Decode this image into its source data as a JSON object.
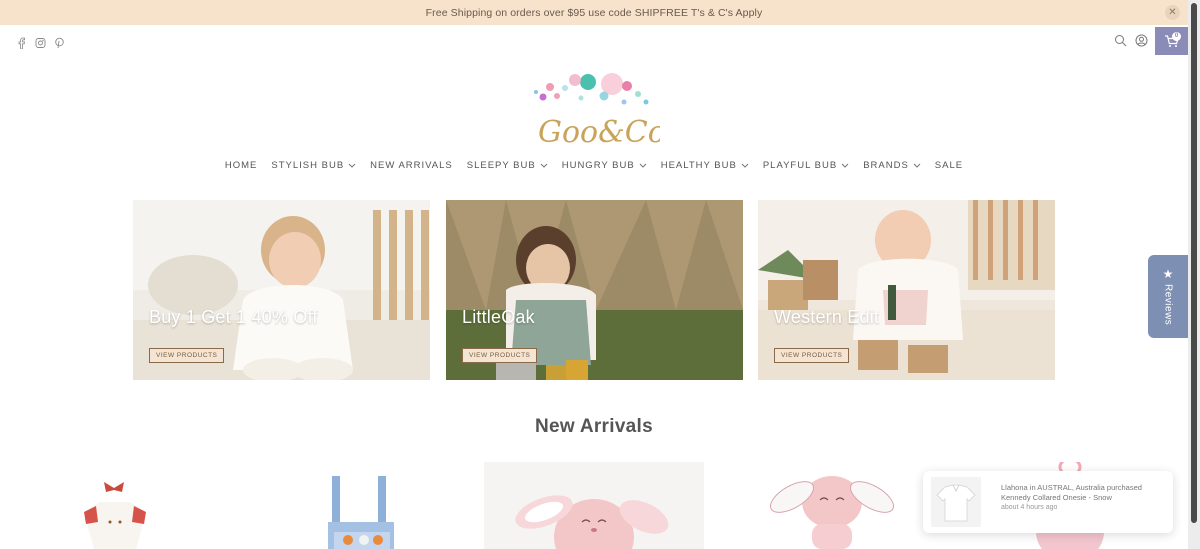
{
  "announcement": {
    "text": "Free Shipping on orders over $95 use code SHIPFREE T's & C's Apply",
    "close_icon": "close-icon"
  },
  "social_icons": [
    "facebook-icon",
    "instagram-icon",
    "pinterest-icon"
  ],
  "header_icons": [
    "search-icon",
    "account-icon",
    "cart-icon"
  ],
  "cart": {
    "count": "0"
  },
  "logo": {
    "text": "Goo & Co."
  },
  "nav": [
    {
      "label": "HOME",
      "dropdown": false
    },
    {
      "label": "STYLISH BUB",
      "dropdown": true
    },
    {
      "label": "NEW ARRIVALS",
      "dropdown": false
    },
    {
      "label": "SLEEPY BUB",
      "dropdown": true
    },
    {
      "label": "HUNGRY BUB",
      "dropdown": true
    },
    {
      "label": "HEALTHY BUB",
      "dropdown": true
    },
    {
      "label": "PLAYFUL BUB",
      "dropdown": true
    },
    {
      "label": "BRANDS",
      "dropdown": true
    },
    {
      "label": "SALE",
      "dropdown": false
    }
  ],
  "hero_cards": [
    {
      "title": "Buy 1 Get 1 40% Off",
      "button": "VIEW PRODUCTS"
    },
    {
      "title": "LittleOak",
      "button": "VIEW PRODUCTS"
    },
    {
      "title": "Western Edit",
      "button": "VIEW PRODUCTS"
    }
  ],
  "new_arrivals": {
    "title": "New Arrivals"
  },
  "reviews_tab": {
    "label": "Reviews",
    "icon": "star-icon"
  },
  "toast": {
    "message": "Llahona in AUSTRAL, Australia purchased Kennedy Collared Onesie - Snow",
    "time": "about 4 hours ago"
  },
  "colors": {
    "announcement_bg": "#f7e2cb",
    "accent": "#8b8bb8",
    "reviews_bg": "#7e8fb4",
    "button_bg": "#f4e4d3"
  }
}
